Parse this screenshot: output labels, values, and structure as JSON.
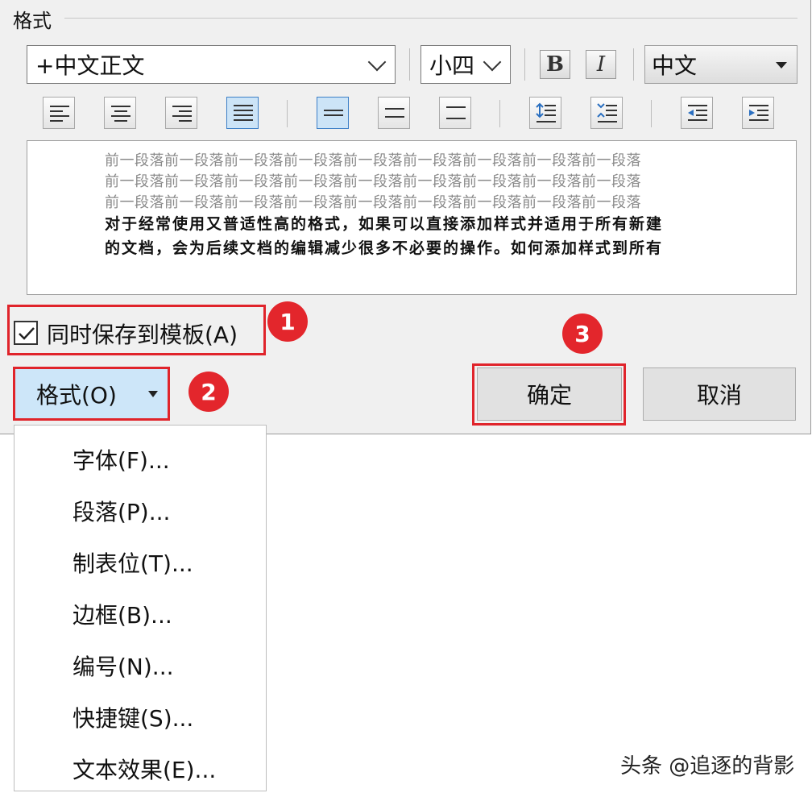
{
  "section": {
    "title": "格式"
  },
  "toolbar": {
    "font_name": "+中文正文",
    "font_size": "小四",
    "bold_label": "B",
    "italic_label": "I",
    "language": "中文"
  },
  "preview": {
    "prev_paragraph_lines": [
      "前一段落前一段落前一段落前一段落前一段落前一段落前一段落前一段落前一段落",
      "前一段落前一段落前一段落前一段落前一段落前一段落前一段落前一段落前一段落",
      "前一段落前一段落前一段落前一段落前一段落前一段落前一段落前一段落前一段落"
    ],
    "sample_lines": [
      "对于经常使用又普适性高的格式，如果可以直接添加样式并适用于所有新建",
      "的文档，会为后续文档的编辑减少很多不必要的操作。如何添加样式到所有"
    ]
  },
  "options": {
    "save_to_template_label": "同时保存到模板(A)",
    "save_to_template_checked": true
  },
  "buttons": {
    "format_label": "格式(O)",
    "ok_label": "确定",
    "cancel_label": "取消"
  },
  "annotations": {
    "badge1": "1",
    "badge2": "2",
    "badge3": "3"
  },
  "format_menu": {
    "items": [
      "字体(F)...",
      "段落(P)...",
      "制表位(T)...",
      "边框(B)...",
      "编号(N)...",
      "快捷键(S)...",
      "文本效果(E)..."
    ]
  },
  "watermark": "头条 @追逐的背影",
  "colors": {
    "highlight_red": "#e0242b",
    "badge_red": "#e3262c",
    "active_blue": "#cce4f7"
  }
}
